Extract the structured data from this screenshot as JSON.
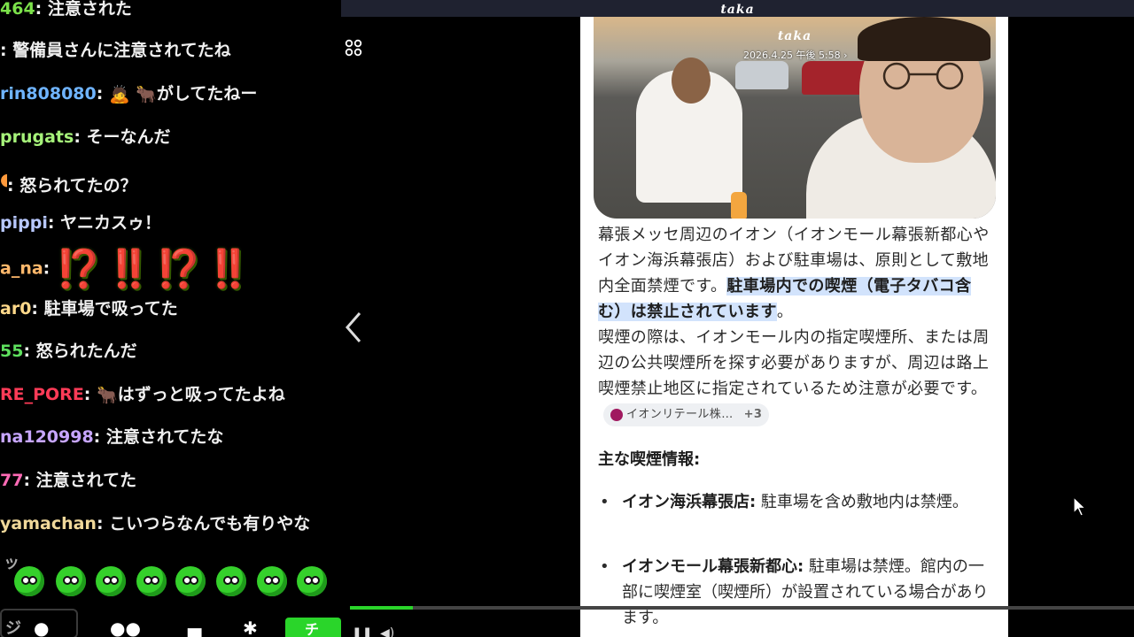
{
  "chat": {
    "lines": [
      {
        "user": "464",
        "sep": ": ",
        "msg": "注意された",
        "color": "#7be04a"
      },
      {
        "user": "",
        "sep": ": ",
        "msg": "警備員さんに注意されてたね",
        "color": "#ffffff"
      },
      {
        "user": "rin808080",
        "sep": ": ",
        "emoji": "🙇 🐂",
        "msg": "がしてたねー",
        "color": "#6fb4ff"
      },
      {
        "user": "prugats",
        "sep": ": ",
        "msg": "そーなんだ",
        "color": "#a6f27a"
      },
      {
        "user": "",
        "sep": ": ",
        "msg": "怒られてたの？",
        "color": "#ff9a3c"
      },
      {
        "user": "pippi",
        "sep": ": ",
        "msg": "ヤニカスゥ！",
        "color": "#b8c8ff"
      },
      {
        "user": "a_na",
        "sep": ": ",
        "sticker": "⁉️‼️⁉️‼️",
        "color": "#ffb86b"
      },
      {
        "user": "ar0",
        "sep": ": ",
        "msg": "駐車場で吸ってた",
        "color": "#ffd98a"
      },
      {
        "user": "55",
        "sep": ": ",
        "msg": "怒られたんだ",
        "color": "#5ee05e"
      },
      {
        "user": "RE_PORE",
        "sep": ": ",
        "emoji": "🐂",
        "msg": "はずっと吸ってたよね",
        "color": "#ff3b57"
      },
      {
        "user": "na120998",
        "sep": ": ",
        "msg": "注意されてたな",
        "color": "#c7a6ff"
      },
      {
        "user": "77",
        "sep": ": ",
        "msg": "注意されてた",
        "color": "#ff6ab5"
      },
      {
        "user": "yamachan",
        "sep": ": ",
        "msg": "こいつらなんでも有りやな",
        "color": "#f0d89a"
      }
    ],
    "side_label": "ッ",
    "side_label_bottom": "ジ",
    "send_label": "チ"
  },
  "viewer": {
    "top_title": "taka",
    "photo": {
      "title": "taka",
      "date": "2026.4.25 午後 5:58 ›"
    },
    "answer": {
      "p1_plain": "幕張メッセ周辺のイオン（イオンモール幕張新都心やイオン海浜幕張店）および駐車場は、原則として敷地内全面禁煙です。",
      "p1_highlight": "駐車場内での喫煙（電子タバコ含む）は禁止されています",
      "p1_end": "。",
      "p2": "喫煙の際は、イオンモール内の指定喫煙所、または周辺の公共喫煙所を探す必要がありますが、周辺は路上喫煙禁止地区に指定されているため注意が必要です。",
      "chip_label": "イオンリテール株…",
      "chip_more": "+3",
      "subheading": "主な喫煙情報:",
      "bullets": [
        {
          "title": "イオン海浜幕張店:",
          "text": " 駐車場を含め敷地内は禁煙。"
        },
        {
          "title": "イオンモール幕張新都心:",
          "text": " 駐車場は禁煙。館内の一部に喫煙室（喫煙所）が設置されている場合があります。"
        }
      ]
    },
    "progress": 0.08,
    "accent": "#2ad52a"
  }
}
